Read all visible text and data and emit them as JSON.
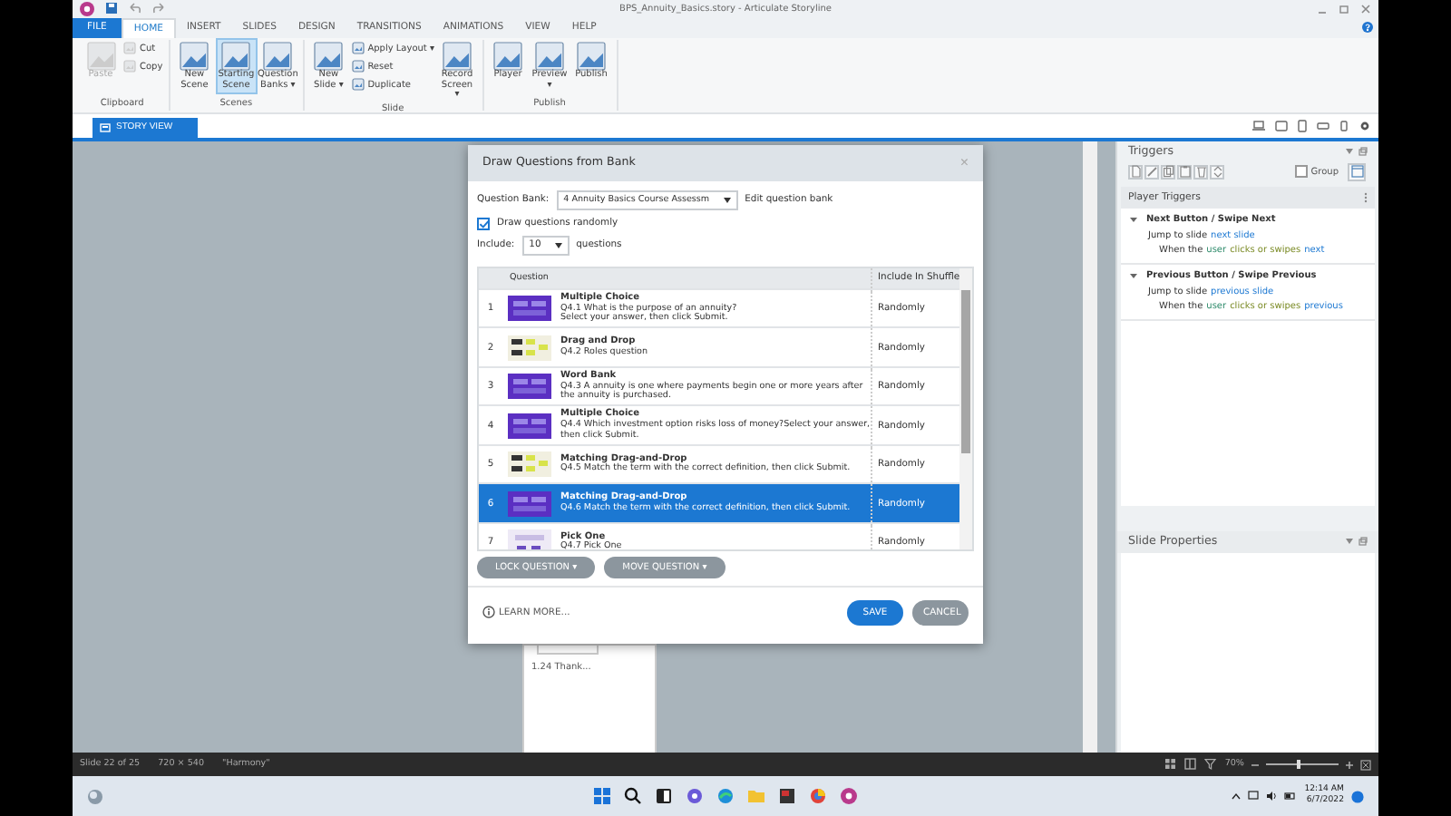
{
  "window": {
    "title": "BPS_Annuity_Basics.story - Articulate Storyline"
  },
  "ribbon_tabs": [
    {
      "label": "FILE",
      "kind": "file",
      "selected": false
    },
    {
      "label": "HOME",
      "kind": "tab",
      "selected": true
    },
    {
      "label": "INSERT",
      "kind": "tab",
      "selected": false
    },
    {
      "label": "SLIDES",
      "kind": "tab",
      "selected": false
    },
    {
      "label": "DESIGN",
      "kind": "tab",
      "selected": false
    },
    {
      "label": "TRANSITIONS",
      "kind": "tab",
      "selected": false
    },
    {
      "label": "ANIMATIONS",
      "kind": "tab",
      "selected": false
    },
    {
      "label": "VIEW",
      "kind": "tab",
      "selected": false
    },
    {
      "label": "HELP",
      "kind": "tab",
      "selected": false
    }
  ],
  "ribbon_groups": [
    {
      "label": "Clipboard",
      "tools": [
        {
          "label": "Paste",
          "kind": "large",
          "disabled": true,
          "selected": false
        },
        {
          "label": "Cut",
          "kind": "small",
          "disabled": true,
          "selected": false
        },
        {
          "label": "Copy",
          "kind": "small",
          "disabled": true,
          "selected": false
        }
      ]
    },
    {
      "label": "Scenes",
      "tools": [
        {
          "label": "New Scene",
          "kind": "large",
          "disabled": false,
          "selected": false
        },
        {
          "label": "Starting Scene",
          "kind": "large",
          "disabled": false,
          "selected": true
        },
        {
          "label": "Question Banks ▾",
          "kind": "large",
          "disabled": false,
          "selected": false
        }
      ]
    },
    {
      "label": "Slide",
      "tools": [
        {
          "label": "New Slide ▾",
          "kind": "large",
          "disabled": false,
          "selected": false
        },
        {
          "label": "Apply Layout ▾",
          "kind": "small",
          "disabled": false,
          "selected": false
        },
        {
          "label": "Reset",
          "kind": "small",
          "disabled": false,
          "selected": false
        },
        {
          "label": "Duplicate",
          "kind": "small",
          "disabled": false,
          "selected": false
        },
        {
          "label": "Record Screen ▾",
          "kind": "large",
          "disabled": false,
          "selected": false
        }
      ]
    },
    {
      "label": "Publish",
      "tools": [
        {
          "label": "Player",
          "kind": "large",
          "disabled": false,
          "selected": false
        },
        {
          "label": "Preview ▾",
          "kind": "large",
          "disabled": false,
          "selected": false
        },
        {
          "label": "Publish",
          "kind": "large",
          "disabled": false,
          "selected": false
        }
      ]
    }
  ],
  "view_tab": {
    "label": "STORY VIEW",
    "selected": true
  },
  "canvas": {
    "slide_caption": "1.24 Thank..."
  },
  "dialog": {
    "title": "Draw Questions from Bank",
    "close": "×",
    "bank_label": "Question Bank:",
    "bank_value": "4 Annuity Basics Course Assessm",
    "edit_link": "Edit question bank",
    "draw_randomly": {
      "label": "Draw questions randomly",
      "checked": true
    },
    "include_label": "Include:",
    "include_value": "10",
    "include_suffix": "questions",
    "columns": [
      "Question",
      "Include In Shuffle"
    ],
    "rows": [
      {
        "number": "1",
        "title": "Multiple Choice",
        "text": "Q4.1 What is the purpose of an annuity?\nSelect your answer, then click Submit.",
        "shuffle": "Randomly",
        "selected": false
      },
      {
        "number": "2",
        "title": "Drag and Drop",
        "text": "Q4.2 Roles question",
        "shuffle": "Randomly",
        "selected": false
      },
      {
        "number": "3",
        "title": "Word Bank",
        "text": "Q4.3 A  annuity is one where payments begin one or more years after the annuity is purchased.",
        "shuffle": "Randomly",
        "selected": false
      },
      {
        "number": "4",
        "title": "Multiple Choice",
        "text": "Q4.4 Which investment option risks loss of money?Select your answer, then click Submit.",
        "shuffle": "Randomly",
        "selected": false
      },
      {
        "number": "5",
        "title": "Matching Drag-and-Drop",
        "text": "Q4.5 Match the term with the correct definition, then click Submit.",
        "shuffle": "Randomly",
        "selected": false
      },
      {
        "number": "6",
        "title": "Matching Drag-and-Drop",
        "text": "Q4.6 Match the term with the correct definition, then click Submit.",
        "shuffle": "Randomly",
        "selected": true
      },
      {
        "number": "7",
        "title": "Pick One",
        "text": "Q4.7 Pick One",
        "shuffle": "Randomly",
        "selected": false
      }
    ],
    "actions": [
      "LOCK QUESTION ▾",
      "MOVE QUESTION ▾"
    ],
    "learn_more": "LEARN MORE...",
    "save": "SAVE",
    "cancel": "CANCEL"
  },
  "triggers": {
    "title": "Triggers",
    "group": {
      "label": "Group",
      "checked": false
    },
    "section": "Player Triggers",
    "items": [
      {
        "name": "Next Button / Swipe Next",
        "expanded": true,
        "action": "Jump to slide",
        "target": "next slide",
        "condition": [
          {
            "text": "When the",
            "kind": "plain"
          },
          {
            "text": "user",
            "kind": "object"
          },
          {
            "text": "clicks or swipes",
            "kind": "event"
          },
          {
            "text": "next",
            "kind": "target"
          }
        ]
      },
      {
        "name": "Previous Button / Swipe Previous",
        "expanded": true,
        "action": "Jump to slide",
        "target": "previous slide",
        "condition": [
          {
            "text": "When the",
            "kind": "plain"
          },
          {
            "text": "user",
            "kind": "object"
          },
          {
            "text": "clicks or swipes",
            "kind": "event"
          },
          {
            "text": "previous",
            "kind": "target"
          }
        ]
      }
    ]
  },
  "slide_properties": {
    "title": "Slide Properties"
  },
  "status_bar": {
    "slide": "Slide 22 of 25",
    "size": "720 × 540",
    "theme": "\"Harmony\"",
    "zoom": "70%",
    "zoom_slider": {
      "level": 0.45
    }
  },
  "taskbar": {
    "time": "12:14 AM",
    "date": "6/7/2022"
  }
}
